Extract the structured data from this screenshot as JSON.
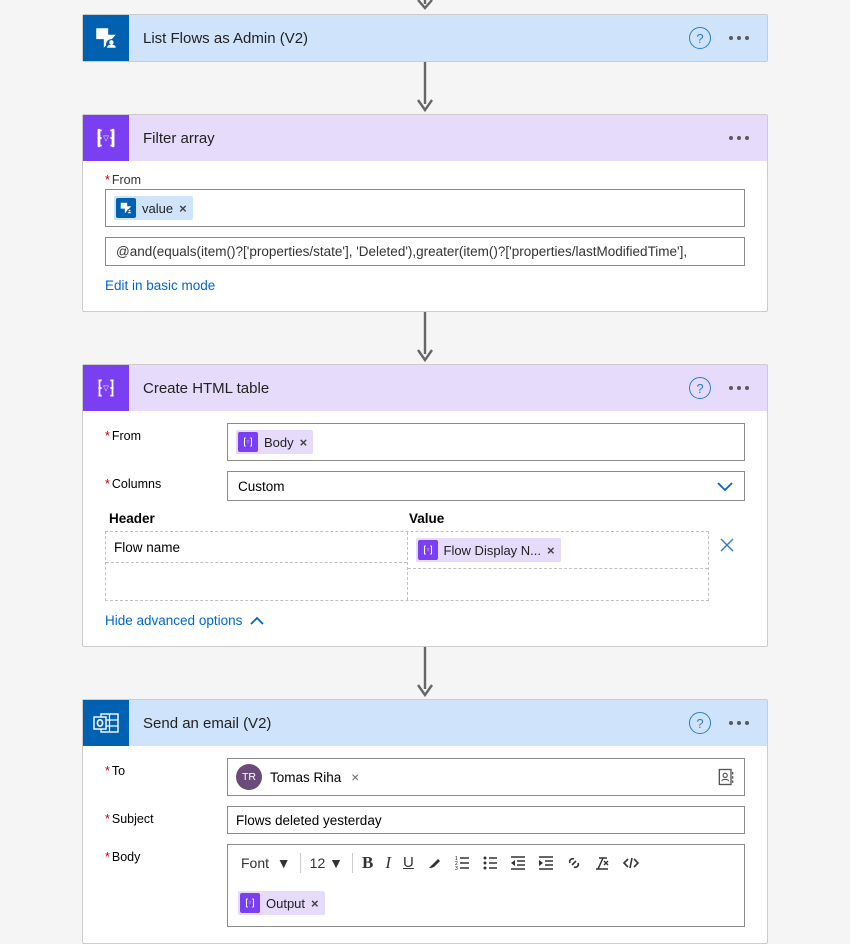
{
  "actions": {
    "listFlows": {
      "title": "List Flows as Admin (V2)"
    },
    "filterArray": {
      "title": "Filter array",
      "from_label": "From",
      "from_token": "value",
      "expression": "@and(equals(item()?['properties/state'], 'Deleted'),greater(item()?['properties/lastModifiedTime'],",
      "edit_link": "Edit in basic mode"
    },
    "createHtmlTable": {
      "title": "Create HTML table",
      "from_label": "From",
      "from_token": "Body",
      "columns_label": "Columns",
      "columns_select": "Custom",
      "header_col": "Header",
      "value_col": "Value",
      "rows": [
        {
          "header": "Flow name",
          "value_token": "Flow Display N..."
        },
        {
          "header": "",
          "value_token": ""
        }
      ],
      "hide_link": "Hide advanced options"
    },
    "sendEmail": {
      "title": "Send an email (V2)",
      "to_label": "To",
      "to_avatar": "TR",
      "to_name": "Tomas Riha",
      "subject_label": "Subject",
      "subject_value": "Flows deleted yesterday",
      "body_label": "Body",
      "font_label": "Font",
      "font_size": "12",
      "body_token": "Output"
    }
  }
}
